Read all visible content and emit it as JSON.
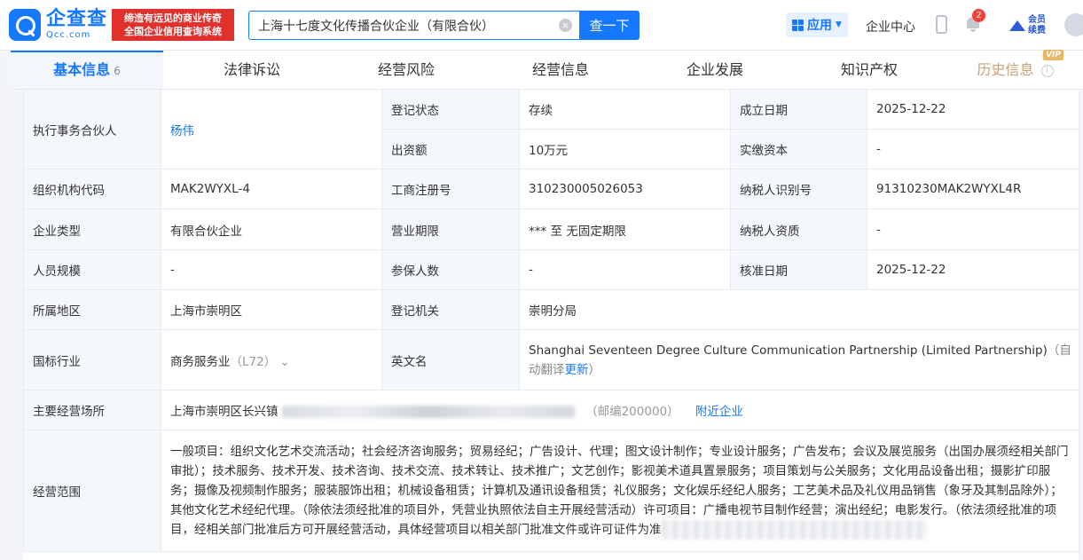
{
  "header": {
    "logo_cn": "企查查",
    "logo_en": "Qcc.com",
    "slogan_line1": "缔造有远见的商业传奇",
    "slogan_line2": "全国企业信用查询系统",
    "search_value": "上海十七度文化传播合伙企业（有限合伙）",
    "search_button": "查一下",
    "app_label": "应用",
    "enterprise_center": "企业中心",
    "notification_count": "2",
    "member_line1": "会员",
    "member_line2": "续费"
  },
  "tabs": [
    {
      "label": "基本信息",
      "count": "6"
    },
    {
      "label": "法律诉讼"
    },
    {
      "label": "经营风险"
    },
    {
      "label": "经营信息"
    },
    {
      "label": "企业发展"
    },
    {
      "label": "知识产权"
    },
    {
      "label": "历史信息",
      "tag": "VIP"
    }
  ],
  "info": {
    "partner_label": "执行事务合伙人",
    "partner_value": "杨伟",
    "reg_status_label": "登记状态",
    "reg_status_value": "存续",
    "found_date_label": "成立日期",
    "found_date_value": "2025-12-22",
    "capital_label": "出资额",
    "capital_value": "10万元",
    "paid_capital_label": "实缴资本",
    "paid_capital_value": "-",
    "org_code_label": "组织机构代码",
    "org_code_value": "MAK2WYXL-4",
    "biz_reg_no_label": "工商注册号",
    "biz_reg_no_value": "310230005026053",
    "taxpayer_id_label": "纳税人识别号",
    "taxpayer_id_value": "91310230MAK2WYXL4R",
    "ent_type_label": "企业类型",
    "ent_type_value": "有限合伙企业",
    "biz_term_label": "营业期限",
    "biz_term_value": "*** 至 无固定期限",
    "taxpayer_qual_label": "纳税人资质",
    "taxpayer_qual_value": "-",
    "staff_size_label": "人员规模",
    "staff_size_value": "-",
    "insured_label": "参保人数",
    "insured_value": "-",
    "approval_date_label": "核准日期",
    "approval_date_value": "2025-12-22",
    "region_label": "所属地区",
    "region_value": "上海市崇明区",
    "reg_authority_label": "登记机关",
    "reg_authority_value": "崇明分局",
    "industry_label": "国标行业",
    "industry_value": "商务服务业",
    "industry_code": "（L72）",
    "english_name_label": "英文名",
    "english_name_value": "Shanghai Seventeen Degree Culture Communication Partnership (Limited Partnership)",
    "english_name_note_a": "（自",
    "english_name_note_b": "动翻译",
    "english_name_update": "更新",
    "english_name_note_c": "）",
    "address_label": "主要经营场所",
    "address_value": "上海市崇明区长兴镇",
    "postcode": "（邮编200000）",
    "nearby": "附近企业",
    "scope_label": "经营范围",
    "scope_value": "一般项目：组织文化艺术交流活动；社会经济咨询服务；贸易经纪；广告设计、代理；图文设计制作；专业设计服务；广告发布；会议及展览服务（出国办展须经相关部门审批）；技术服务、技术开发、技术咨询、技术交流、技术转让、技术推广；文艺创作；影视美术道具置景服务；项目策划与公关服务；文化用品设备出租；摄影扩印服务；摄像及视频制作服务；服装服饰出租；机械设备租赁；计算机及通讯设备租赁；礼仪服务；文化娱乐经纪人服务；工艺美术品及礼仪用品销售（象牙及其制品除外）；其他文化艺术经纪代理。（除依法须经批准的项目外，凭营业执照依法自主开展经营活动）许可项目：广播电视节目制作经营；演出经纪；电影发行。（依法须经批准的项目，经相关部门批准后方可开展经营活动，具体经营项目以相关部门批准文件或许可证件为准"
  }
}
